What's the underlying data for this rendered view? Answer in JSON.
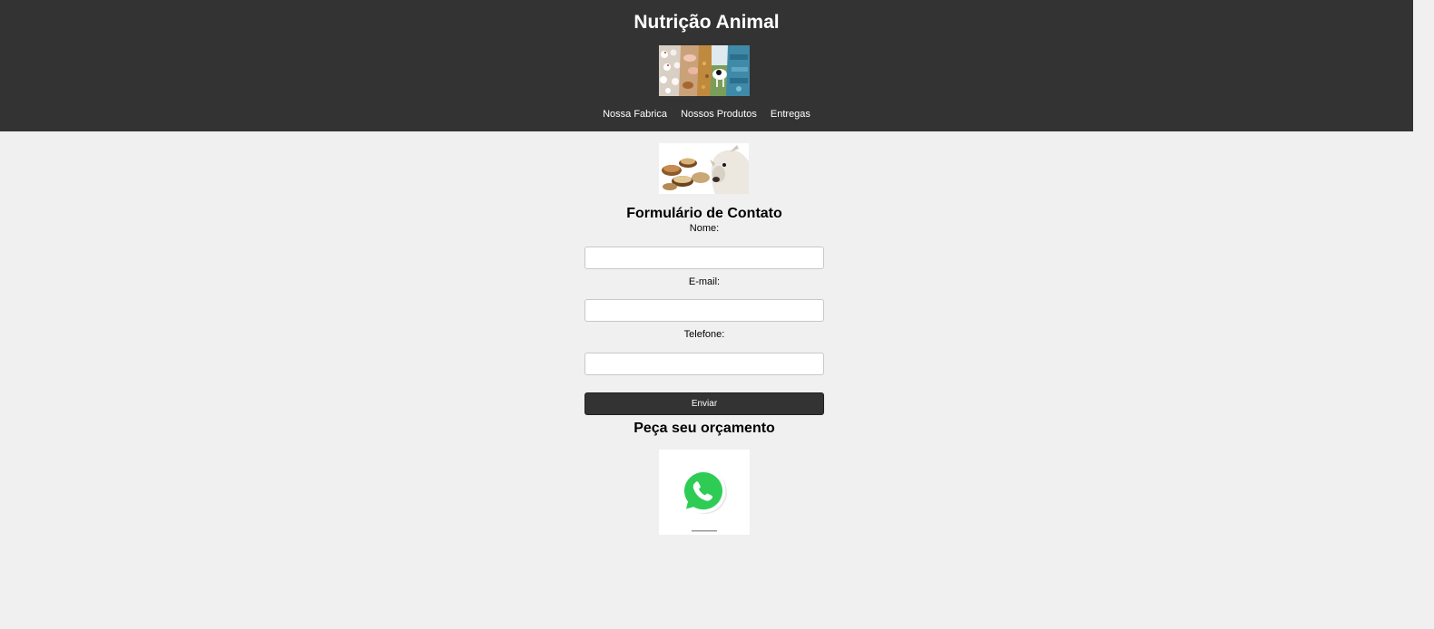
{
  "header": {
    "title": "Nutrição Animal",
    "image_name": "animal-collage-image",
    "nav": [
      {
        "label": "Nossa Fabrica"
      },
      {
        "label": "Nossos Produtos"
      },
      {
        "label": "Entregas"
      }
    ]
  },
  "main": {
    "image_name": "feed-and-cattle-image",
    "form": {
      "title": "Formulário de Contato",
      "fields": [
        {
          "label": "Nome:",
          "value": "",
          "placeholder": ""
        },
        {
          "label": "E-mail:",
          "value": "",
          "placeholder": ""
        },
        {
          "label": "Telefone:",
          "value": "",
          "placeholder": ""
        }
      ],
      "submit_label": "Enviar"
    },
    "quote": {
      "title": "Peça seu orçamento",
      "icon": "whatsapp-icon"
    }
  },
  "colors": {
    "header_bg": "#333333",
    "page_bg": "#f0f0f0",
    "button_bg": "#333333",
    "whatsapp_green": "#25d366"
  }
}
